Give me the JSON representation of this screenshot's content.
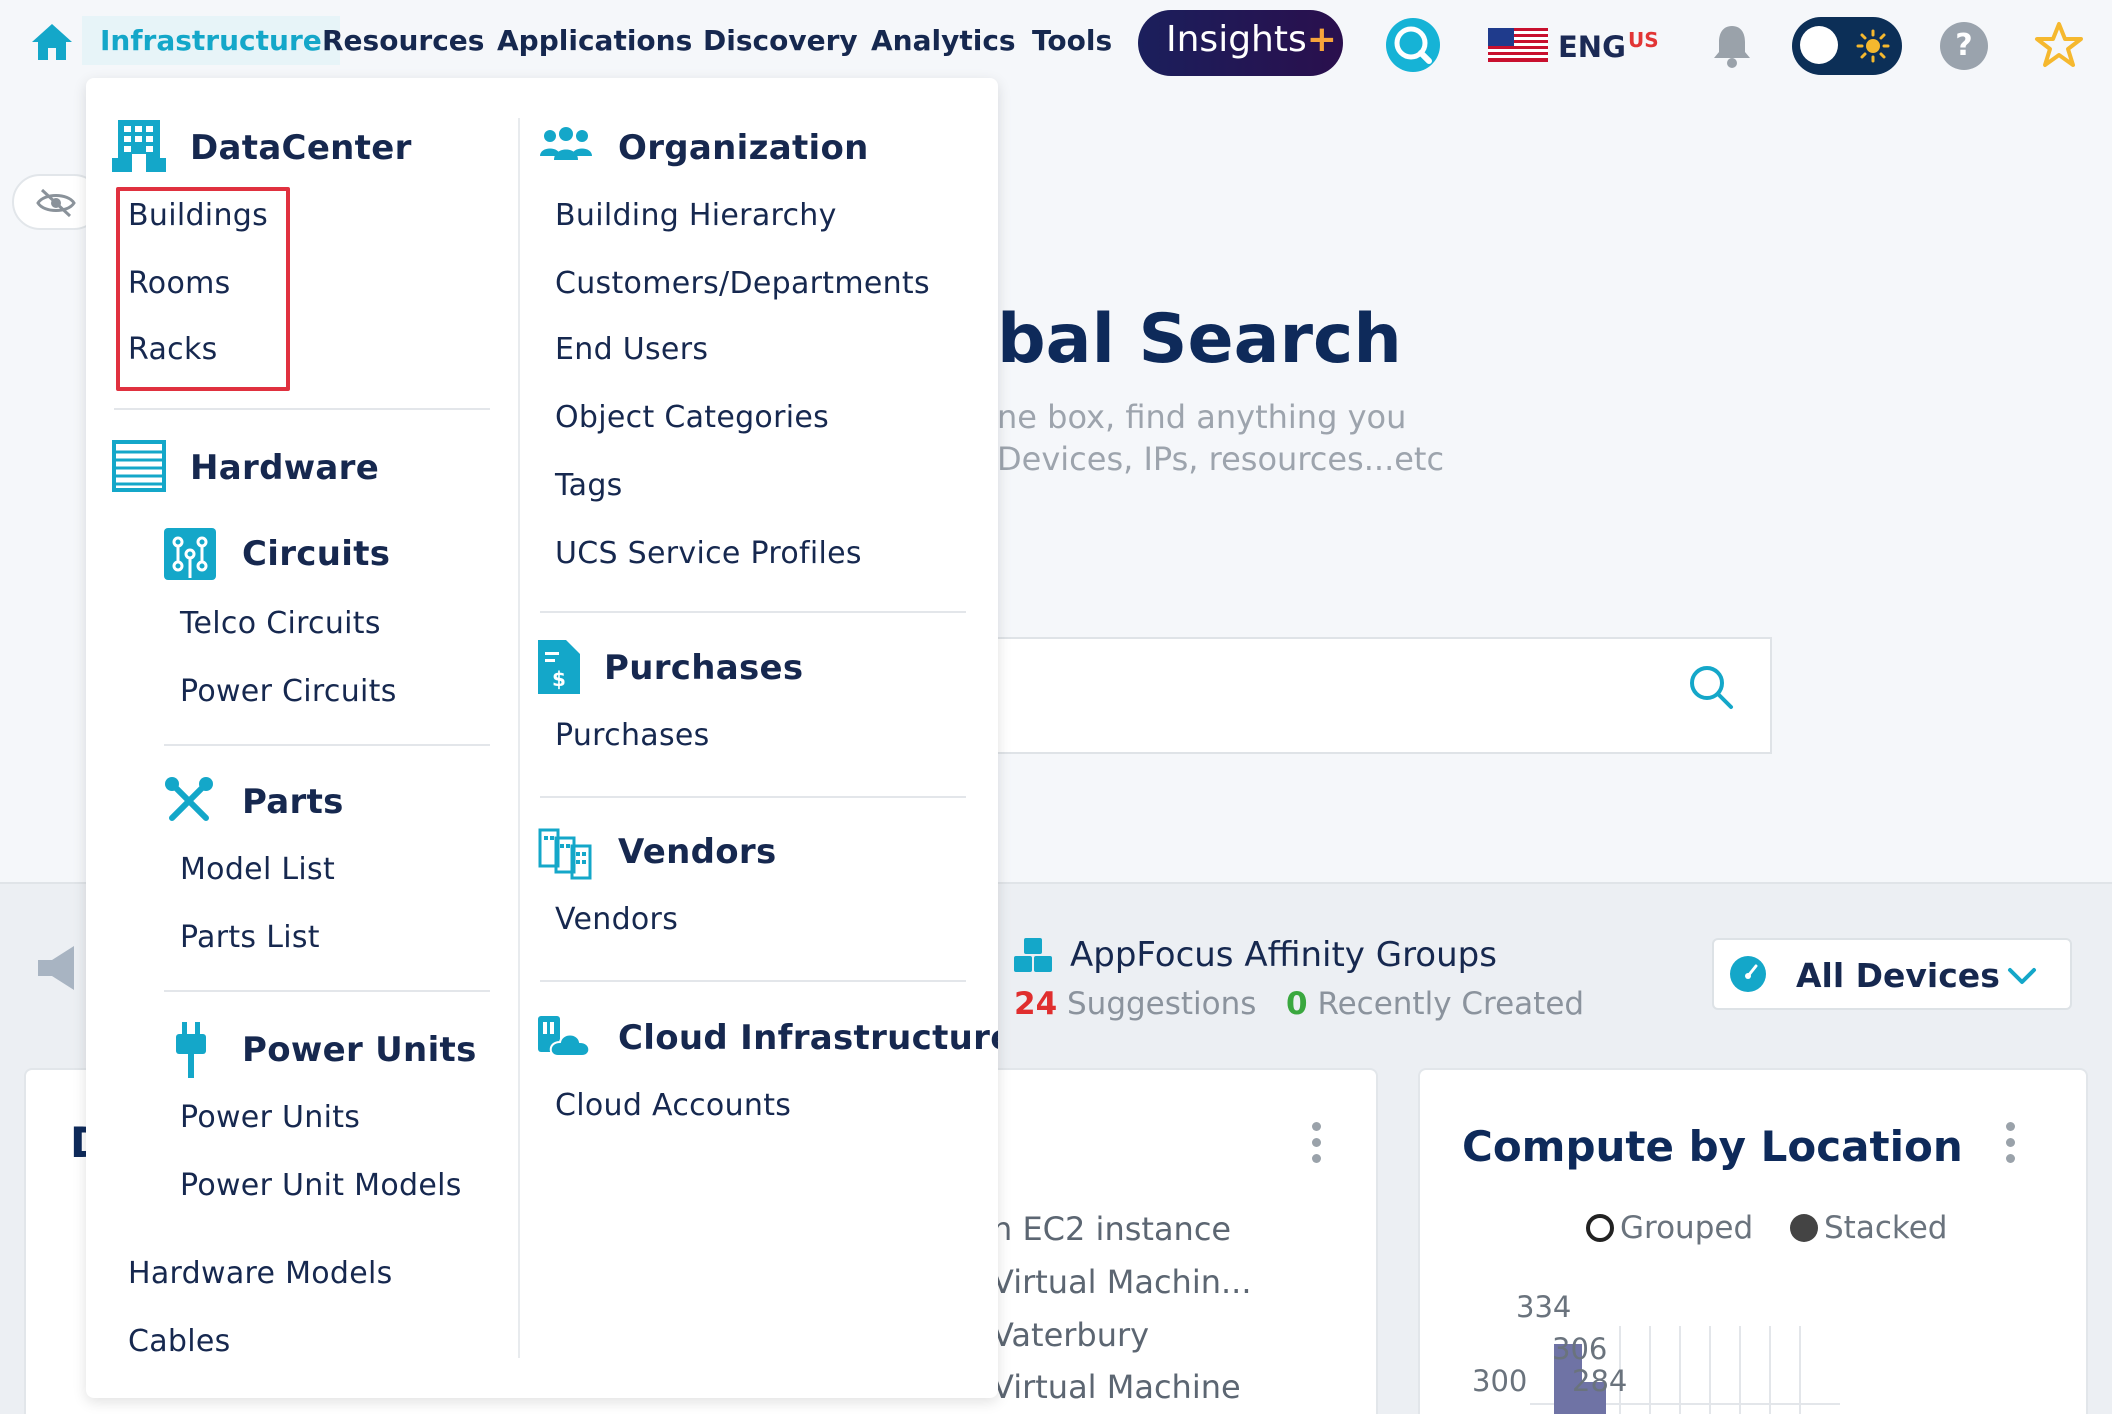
{
  "nav": {
    "items": [
      "Infrastructure",
      "Resources",
      "Applications",
      "Discovery",
      "Analytics",
      "Tools"
    ],
    "insights_label": "Insights",
    "insights_plus": "+",
    "lang": "ENG",
    "lang_region": "US",
    "help_glyph": "?"
  },
  "page": {
    "hero_title": "bal Search",
    "hero_sub_1": "ne box, find anything you",
    "hero_sub_2": "Devices, IPs, resources...etc",
    "appfocus_title": "AppFocus Affinity Groups",
    "suggestions_count": "24",
    "suggestions_label": "Suggestions",
    "recent_count": "0",
    "recent_label": "Recently Created",
    "device_filter": "All Devices",
    "card_left_letter": "D",
    "card_left_lines": [
      "n EC2 instance",
      "Virtual Machin...",
      "Vaterbury",
      "Virtual Machine"
    ],
    "compute_title": "Compute by Location",
    "radio_grouped": "Grouped",
    "radio_stacked": "Stacked",
    "chart_labels": [
      "334",
      "306",
      "300",
      "284"
    ]
  },
  "menu": {
    "datacenter": {
      "title": "DataCenter",
      "items": [
        "Buildings",
        "Rooms",
        "Racks"
      ]
    },
    "hardware": {
      "title": "Hardware"
    },
    "circuits": {
      "title": "Circuits",
      "items": [
        "Telco Circuits",
        "Power Circuits"
      ]
    },
    "parts": {
      "title": "Parts",
      "items": [
        "Model List",
        "Parts List"
      ]
    },
    "power_units": {
      "title": "Power Units",
      "items": [
        "Power Units",
        "Power Unit Models"
      ]
    },
    "hardware_items": [
      "Hardware Models",
      "Cables"
    ],
    "organization": {
      "title": "Organization",
      "items": [
        "Building Hierarchy",
        "Customers/Departments",
        "End Users",
        "Object Categories",
        "Tags",
        "UCS Service Profiles"
      ]
    },
    "purchases": {
      "title": "Purchases",
      "items": [
        "Purchases"
      ]
    },
    "vendors": {
      "title": "Vendors",
      "items": [
        "Vendors"
      ]
    },
    "cloud": {
      "title": "Cloud Infrastructure",
      "items": [
        "Cloud Accounts"
      ]
    }
  },
  "colors": {
    "accent": "#14a7c9",
    "navy": "#16284f",
    "highlight": "#e0313f"
  }
}
